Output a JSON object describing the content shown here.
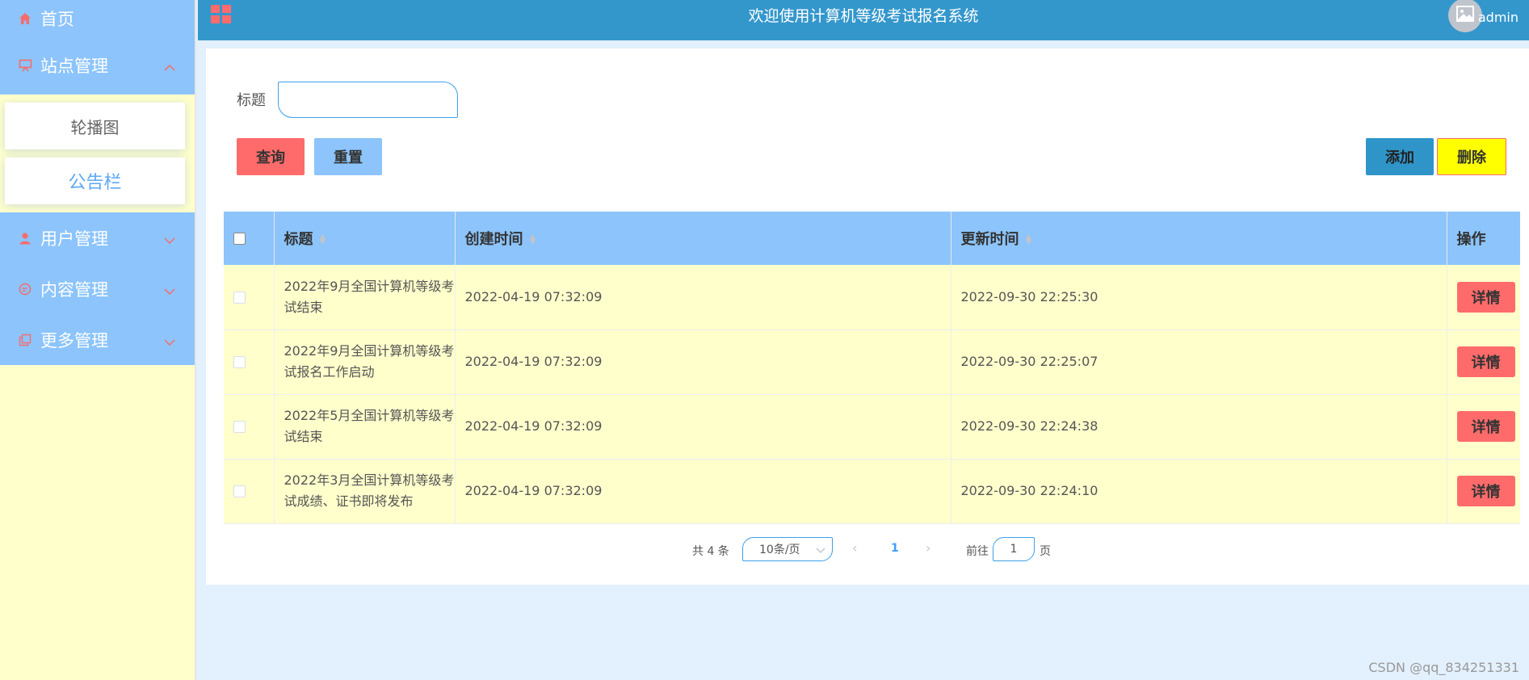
{
  "sidebar": {
    "items": [
      {
        "label": "首页",
        "icon": "home-icon"
      },
      {
        "label": "站点管理",
        "icon": "monitor-icon",
        "expanded": true,
        "children": [
          {
            "label": "轮播图"
          },
          {
            "label": "公告栏",
            "active": true
          }
        ]
      },
      {
        "label": "用户管理",
        "icon": "user-icon"
      },
      {
        "label": "内容管理",
        "icon": "chat-icon"
      },
      {
        "label": "更多管理",
        "icon": "copy-icon"
      }
    ]
  },
  "header": {
    "title": "欢迎使用计算机等级考试报名系统",
    "username": "admin"
  },
  "search": {
    "label": "标题",
    "value": "",
    "placeholder": ""
  },
  "buttons": {
    "query": "查询",
    "reset": "重置",
    "add": "添加",
    "delete": "删除"
  },
  "table": {
    "columns": [
      "标题",
      "创建时间",
      "更新时间",
      "操作"
    ],
    "rows": [
      {
        "title": "2022年9月全国计算机等级考试结束",
        "created": "2022-04-19 07:32:09",
        "updated": "2022-09-30 22:25:30",
        "action": "详情"
      },
      {
        "title": "2022年9月全国计算机等级考试报名工作启动",
        "created": "2022-04-19 07:32:09",
        "updated": "2022-09-30 22:25:07",
        "action": "详情"
      },
      {
        "title": "2022年5月全国计算机等级考试结束",
        "created": "2022-04-19 07:32:09",
        "updated": "2022-09-30 22:24:38",
        "action": "详情"
      },
      {
        "title": "2022年3月全国计算机等级考试成绩、证书即将发布",
        "created": "2022-04-19 07:32:09",
        "updated": "2022-09-30 22:24:10",
        "action": "详情"
      }
    ]
  },
  "pagination": {
    "total": "共 4 条",
    "page_size": "10条/页",
    "current_page": "1",
    "goto_label": "前往",
    "goto_value": "1",
    "goto_unit": "页"
  },
  "watermark": "CSDN @qq_834251331",
  "colors": {
    "sidebar_menu": "#8cc4fb",
    "sidebar_bg": "#ffffcc",
    "header": "#3497cc",
    "query_button": "#ff6b6b",
    "reset_button": "#8cc4fb",
    "add_button": "#2f95c9",
    "delete_button": "#ffff00",
    "table_header": "#8cc4fb",
    "table_row": "#ffffcc",
    "detail_button": "#ff6b6b",
    "icon_red": "#f56c6c"
  }
}
